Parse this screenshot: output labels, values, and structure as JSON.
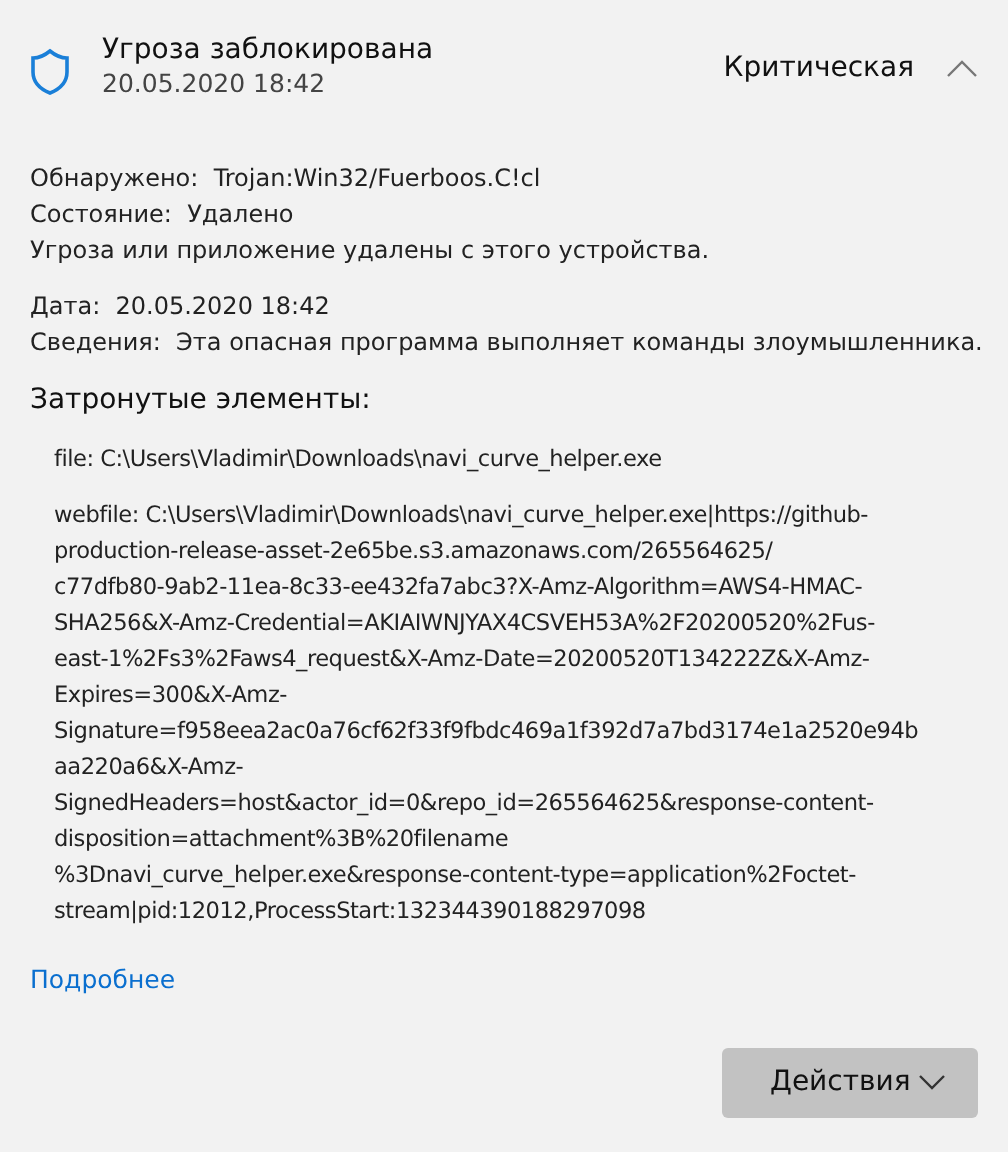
{
  "header": {
    "title": "Угроза заблокирована",
    "date": "20.05.2020 18:42",
    "severity": "Критическая",
    "expanded": true
  },
  "details": [
    {
      "label": "Обнаружено:",
      "value": "Trojan:Win32/Fuerboos.C!cl"
    },
    {
      "label": "Состояние:",
      "value": "Удалено"
    },
    {
      "value": "Угроза или приложение удалены с этого устройства."
    }
  ],
  "details_2": [
    {
      "label": "Дата:",
      "value": "20.05.2020 18:42"
    },
    {
      "label": "Сведения:",
      "value": "Эта опасная программа выполняет команды злоумышленника."
    }
  ],
  "affected_heading": "Затронутые элементы:",
  "affected_items": [
    [
      "file: C:\\Users\\Vladimir\\Downloads\\navi_curve_helper.exe"
    ],
    [
      "webfile: C:\\Users\\Vladimir\\Downloads\\navi_curve_helper.exe|https://github-",
      "production-release-asset-2e65be.s3.amazonaws.com/265564625/",
      "c77dfb80-9ab2-11ea-8c33-ee432fa7abc3?X-Amz-Algorithm=AWS4-HMAC-",
      "SHA256&X-Amz-Credential=AKIAIWNJYAX4CSVEH53A%2F20200520%2Fus-",
      "east-1%2Fs3%2Faws4_request&X-Amz-Date=20200520T134222Z&X-Amz-",
      "Expires=300&X-Amz-",
      "Signature=f958eea2ac0a76cf62f33f9fbdc469a1f392d7a7bd3174e1a2520e94b",
      "aa220a6&X-Amz-",
      "SignedHeaders=host&actor_id=0&repo_id=265564625&response-content-",
      "disposition=attachment%3B%20filename",
      "%3Dnavi_curve_helper.exe&response-content-type=application%2Foctet-",
      "stream|pid:12012,ProcessStart:132344390188297098"
    ]
  ],
  "more_link": "Подробнее",
  "actions_button": "Действия"
}
